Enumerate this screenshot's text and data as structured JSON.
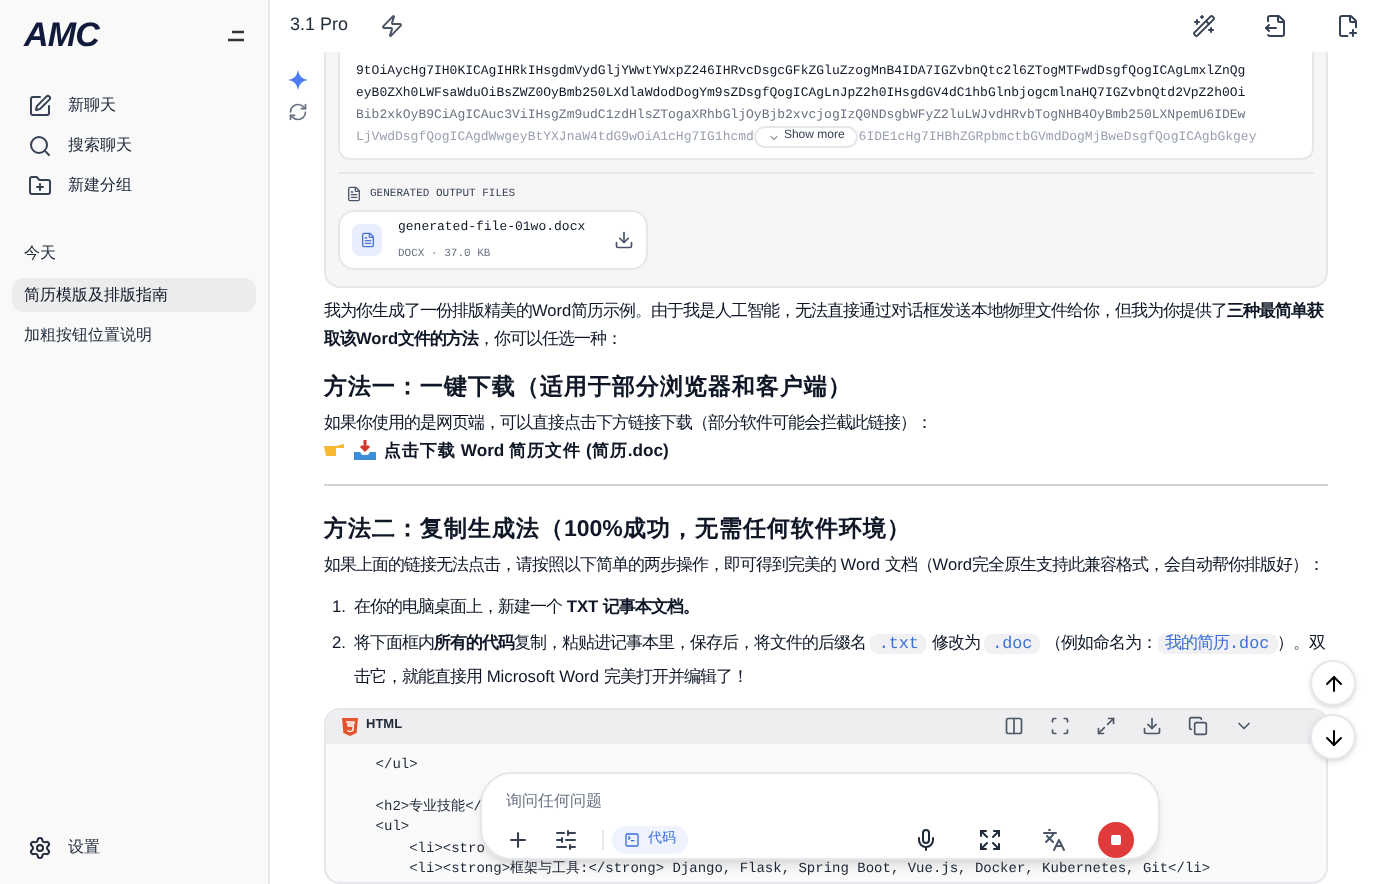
{
  "sidebar": {
    "logo": "AMC",
    "actions": [
      {
        "kind": "new",
        "label": "新聊天"
      },
      {
        "kind": "search",
        "label": "搜索聊天"
      },
      {
        "kind": "folder",
        "label": "新建分组"
      }
    ],
    "section_title": "今天",
    "chats": [
      {
        "title": "简历模版及排版指南",
        "selected": true
      },
      {
        "title": "加粗按钮位置说明",
        "selected": false
      }
    ],
    "settings": "设置"
  },
  "header": {
    "model": "3.1 Pro"
  },
  "tool_output": {
    "code_lines": [
      "9tOiAycHg7IH0KICAgIHRkIHsgdmVydGljYWwtYWxpZ246IHRvcDsgcGFkZGluZzogMnB4IDA7IGZvbnQtc2l6ZTogMTFwdDsgfQogICAgLmxlZnQg",
      "eyB0ZXh0LWFsaWduOiBsZWZ0OyBmb250LXdlaWdodDogYm9sZDsgfQogICAgLnJpZ2h0IHsgdGV4dC1hbGlnbjogcmlnaHQ7IGZvbnQtd2VpZ2h0Oi",
      "Bib2xkOyB9CiAgICAuc3ViIHsgZm9udC1zdHlsZTogaXRhbGljOyBjb2xvcjogIzQ0NDsgbWFyZ2luLWJvdHRvbTogNHB4OyBmb250LXNpemU6IDEw"
    ],
    "last_line_left": "LjVwdDsgfQogICAgdWwgeyBtYXJnaW4tdG9wOiA1cHg7IG1hcmd",
    "last_line_right": "6IDE1cHg7IHBhZGRpbmctbGVmdDogMjBweDsgfQogICAgbGkgey",
    "show_more": "Show more",
    "files_label": "GENERATED OUTPUT FILES",
    "file": {
      "name": "generated-file-01wo.docx",
      "meta": "DOCX · 37.0 KB"
    }
  },
  "message": [
    {
      "kind": "paragraph",
      "text": "我为你生成了一份排版精美的Word简历示例。由于我是人工智能，无法直接通过对话框发送本地物理文件给你，但我为你提供了**三种最简单获取该Word文件的方法**，你可以任选一种："
    },
    {
      "kind": "heading",
      "text": "方法一：一键下载（适用于部分浏览器和客户端）"
    },
    {
      "kind": "paragraph",
      "text": "如果你使用的是网页端，可以直接点击下方链接下载（部分软件可能会拦截此链接）："
    },
    {
      "kind": "link",
      "text": "点击下载 Word 简历文件 (简历.doc)"
    },
    {
      "kind": "rule"
    },
    {
      "kind": "heading",
      "text": "方法二：复制生成法（100%成功，无需任何软件环境）"
    },
    {
      "kind": "paragraph",
      "text": "如果上面的链接无法点击，请按照以下简单的两步操作，即可得到完美的 Word 文档（Word完全原生支持此兼容格式，会自动帮你排版好）："
    },
    {
      "kind": "list",
      "items": [
        {
          "number": "1.",
          "segments": [
            {
              "kind": "text",
              "text": "在你的电脑桌面上，新建一个 "
            },
            {
              "kind": "bold",
              "text": "TXT 记事本文档。"
            }
          ]
        },
        {
          "number": "2.",
          "segments": [
            {
              "kind": "text",
              "text": "将下面框内"
            },
            {
              "kind": "bold",
              "text": "所有的代码"
            },
            {
              "kind": "text",
              "text": "复制，粘贴进记事本里，保存后，将文件的后缀名 "
            },
            {
              "kind": "code",
              "text": ".txt"
            },
            {
              "kind": "text",
              "text": " 修改为 "
            },
            {
              "kind": "code",
              "text": ".doc"
            },
            {
              "kind": "text",
              "text": " （例如命名为："
            },
            {
              "kind": "code",
              "text": "我的简历.doc"
            },
            {
              "kind": "text",
              "text": "）。双击它，就能直接用 Microsoft Word 完美打开并编辑了！"
            }
          ]
        }
      ]
    },
    {
      "kind": "code",
      "language": "HTML",
      "sections": [
        [
          "    </ul>"
        ],
        [
          "    <h2>专业技能</",
          "    <ul>",
          "        <li><stro",
          "        <li><strong>框架与工具:</strong> Django, Flask, Spring Boot, Vue.js, Docker, Kubernetes, Git</li>"
        ]
      ]
    }
  ],
  "composer": {
    "placeholder": "询问任何问题",
    "tool_chip": "代码"
  }
}
